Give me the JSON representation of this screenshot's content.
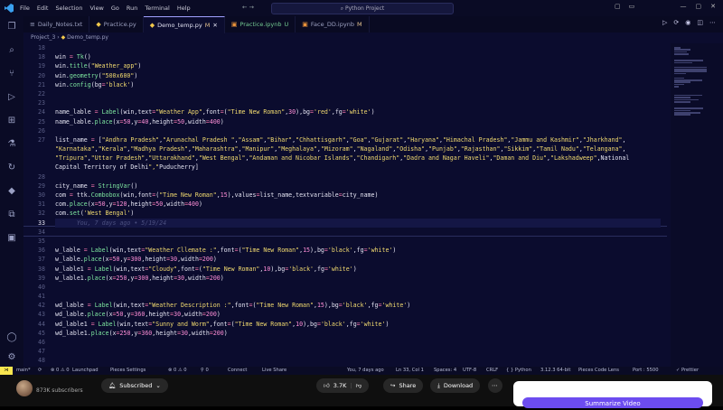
{
  "window": {
    "title": "Python Project"
  },
  "menu": [
    "File",
    "Edit",
    "Selection",
    "View",
    "Go",
    "Run",
    "Terminal",
    "Help"
  ],
  "tabs": [
    {
      "label": "Daily_Notes.txt",
      "icon": "≡",
      "mod": "",
      "active": false,
      "color": "normal"
    },
    {
      "label": "Practice.py",
      "icon": "◆",
      "mod": "",
      "active": false,
      "color": "normal"
    },
    {
      "label": "Demo_temp.py",
      "icon": "◆",
      "mod": "M",
      "active": true,
      "color": "normal"
    },
    {
      "label": "Practice.ipynb",
      "icon": "▣",
      "mod": "U",
      "active": false,
      "color": "green"
    },
    {
      "label": "Face_DD.ipynb",
      "icon": "▣",
      "mod": "M",
      "active": false,
      "color": "normal"
    }
  ],
  "breadcrumb": {
    "folder": "Project_3",
    "file": "Demo_temp.py",
    "separator": "›"
  },
  "editor": {
    "lines": [
      {
        "n": "18",
        "code": ""
      },
      {
        "n": "18",
        "code": "win = Tk()"
      },
      {
        "n": "19",
        "code": "win.title(\"Weather_app\")"
      },
      {
        "n": "20",
        "code": "win.geometry(\"500x600\")"
      },
      {
        "n": "21",
        "code": "win.config(bg='black')"
      },
      {
        "n": "22",
        "code": ""
      },
      {
        "n": "23",
        "code": ""
      },
      {
        "n": "24",
        "code": "name_lable = Label(win,text=\"Weather App\",font=(\"Time New Roman\",30),bg='red',fg='white')"
      },
      {
        "n": "25",
        "code": "name_lable.place(x=50,y=40,height=50,width=400)"
      },
      {
        "n": "26",
        "code": ""
      },
      {
        "n": "27",
        "code": "list_name = [\"Andhra Pradesh\",\"Arunachal Pradesh \",\"Assam\",\"Bihar\",\"Chhattisgarh\",\"Goa\",\"Gujarat\",\"Haryana\",\"Himachal Pradesh\",\"Jammu and Kashmir\",\"Jharkhand\","
      },
      {
        "n": "",
        "code": "\"Karnataka\",\"Kerala\",\"Madhya Pradesh\",\"Maharashtra\",\"Manipur\",\"Meghalaya\",\"Mizoram\",\"Nagaland\",\"Odisha\",\"Punjab\",\"Rajasthan\",\"Sikkim\",\"Tamil Nadu\",\"Telangana\","
      },
      {
        "n": "",
        "code": "\"Tripura\",\"Uttar Pradesh\",\"Uttarakhand\",\"West Bengal\",\"Andaman and Nicobar Islands\",\"Chandigarh\",\"Dadra and Nagar Haveli\",\"Daman and Diu\",\"Lakshadweep\",\"National"
      },
      {
        "n": "",
        "code": "Capital Territory of Delhi\",\"Puducherry\"]"
      },
      {
        "n": "28",
        "code": ""
      },
      {
        "n": "29",
        "code": "city_name = StringVar()"
      },
      {
        "n": "30",
        "code": "com = ttk.Combobox(win,font=(\"Time New Roman\",15),values=list_name,textvariable=city_name)"
      },
      {
        "n": "31",
        "code": "com.place(x=50,y=120,height=50,width=400)"
      },
      {
        "n": "32",
        "code": "com.set('West Bengal')"
      },
      {
        "n": "33",
        "code": "      You, 7 days ago • 5/19/24",
        "cur": true
      },
      {
        "n": "34",
        "code": ""
      },
      {
        "n": "35",
        "code": ""
      },
      {
        "n": "36",
        "code": "w_lable = Label(win,text=\"Weather Cllemate :\",font=(\"Time New Roman\",15),bg='black',fg='white')"
      },
      {
        "n": "37",
        "code": "w_lable.place(x=50,y=300,height=30,width=200)"
      },
      {
        "n": "38",
        "code": "w_lable1 = Label(win,text=\"Cloudy\",font=(\"Time New Roman\",10),bg='black',fg='white')"
      },
      {
        "n": "39",
        "code": "w_lable1.place(x=250,y=300,height=30,width=200)"
      },
      {
        "n": "40",
        "code": ""
      },
      {
        "n": "41",
        "code": ""
      },
      {
        "n": "42",
        "code": "wd_lable = Label(win,text=\"Weather Description :\",font=(\"Time New Roman\",15),bg='black',fg='white')"
      },
      {
        "n": "43",
        "code": "wd_lable.place(x=50,y=360,height=30,width=200)"
      },
      {
        "n": "44",
        "code": "wd_lable1 = Label(win,text=\"Sunny and Worm\",font=(\"Time New Roman\",10),bg='black',fg='white')"
      },
      {
        "n": "45",
        "code": "wd_lable1.place(x=250,y=360,height=30,width=200)"
      },
      {
        "n": "46",
        "code": ""
      },
      {
        "n": "47",
        "code": ""
      },
      {
        "n": "48",
        "code": ""
      }
    ]
  },
  "status": {
    "branch": "main*",
    "sync": "⟳",
    "errors": "⊗ 0 ⚠ 0",
    "ports": "⚲ 0",
    "connect": "Connect",
    "launchpad": "Launchpad",
    "pieces": "Pieces Settings",
    "live": "Live Share",
    "blame": "You, 7 days ago",
    "cursor": "Ln 33, Col 1",
    "spaces": "Spaces: 4",
    "encoding": "UTF-8",
    "eol": "CRLF",
    "lang": "{ } Python",
    "interp": "3.12.3 64-bit",
    "lens": "Pieces Code Lens",
    "port": "Port : 5500",
    "prettier": "✓ Prettier"
  },
  "youtube": {
    "subscribers": "873K subscribers",
    "subscribe": "Subscribed",
    "likes": "3.7K",
    "share": "Share",
    "download": "Download",
    "summarize": "Summarize Video"
  }
}
